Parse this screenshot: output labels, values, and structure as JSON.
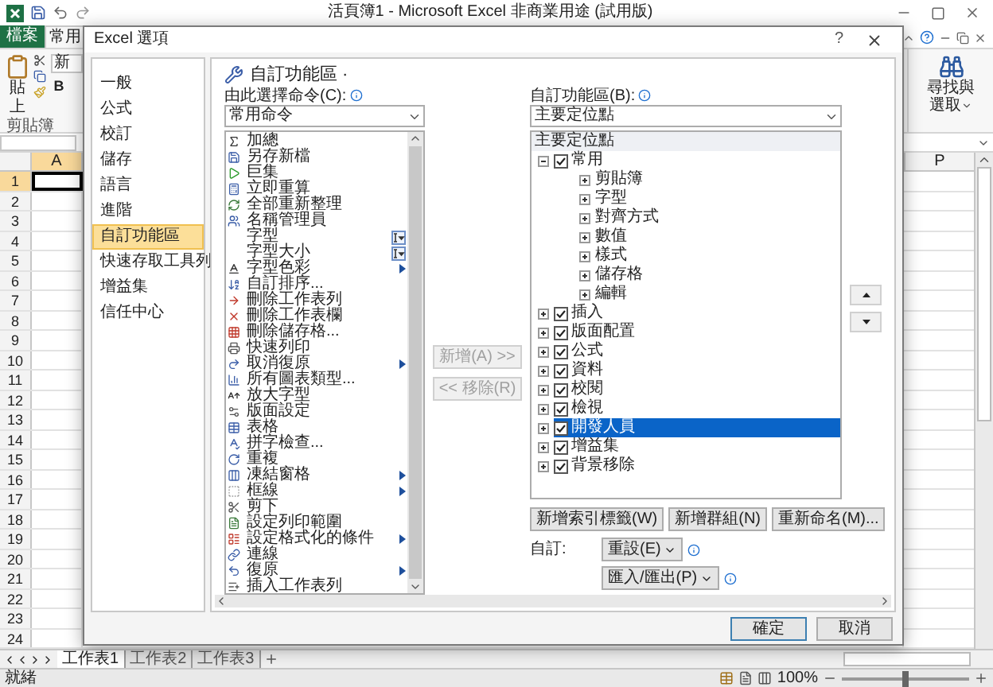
{
  "excel": {
    "title": "活頁簿1 - Microsoft Excel 非商業用途 (試用版)",
    "file_tab": "檔案",
    "tabs": [
      {
        "label": "常用",
        "selected": true
      }
    ],
    "paste": "貼上",
    "font_box": "新",
    "bold": "B",
    "clipboard_group": "剪貼簿",
    "find_select": [
      "尋找與",
      "選取"
    ],
    "columns": [
      {
        "label": "A",
        "selected": true
      },
      {
        "label": "P",
        "selected": false
      }
    ],
    "rows": [
      {
        "label": "1",
        "selected": true
      },
      {
        "label": "2",
        "selected": false
      },
      {
        "label": "3",
        "selected": false
      },
      {
        "label": "4",
        "selected": false
      },
      {
        "label": "5",
        "selected": false
      },
      {
        "label": "6",
        "selected": false
      },
      {
        "label": "7",
        "selected": false
      },
      {
        "label": "8",
        "selected": false
      },
      {
        "label": "9",
        "selected": false
      },
      {
        "label": "10",
        "selected": false
      },
      {
        "label": "11",
        "selected": false
      },
      {
        "label": "12",
        "selected": false
      },
      {
        "label": "13",
        "selected": false
      },
      {
        "label": "14",
        "selected": false
      },
      {
        "label": "15",
        "selected": false
      },
      {
        "label": "16",
        "selected": false
      },
      {
        "label": "17",
        "selected": false
      },
      {
        "label": "18",
        "selected": false
      },
      {
        "label": "19",
        "selected": false
      },
      {
        "label": "20",
        "selected": false
      },
      {
        "label": "21",
        "selected": false
      },
      {
        "label": "22",
        "selected": false
      },
      {
        "label": "23",
        "selected": false
      },
      {
        "label": "24",
        "selected": false
      }
    ],
    "sheets": [
      {
        "label": "工作表1",
        "selected": true
      },
      {
        "label": "工作表2",
        "selected": false
      },
      {
        "label": "工作表3",
        "selected": false
      }
    ],
    "status_bar": {
      "status": "就緒",
      "zoom": "100%",
      "level": 0.5
    }
  },
  "dialog": {
    "title": "Excel 選項",
    "help": "?",
    "nav": [
      {
        "label": "一般",
        "selected": false
      },
      {
        "label": "公式",
        "selected": false
      },
      {
        "label": "校訂",
        "selected": false
      },
      {
        "label": "儲存",
        "selected": false
      },
      {
        "label": "語言",
        "selected": false
      },
      {
        "label": "進階",
        "selected": false
      },
      {
        "label": "自訂功能區",
        "selected": true
      },
      {
        "label": "快速存取工具列",
        "selected": false
      },
      {
        "label": "增益集",
        "selected": false
      },
      {
        "label": "信任中心",
        "selected": false
      }
    ],
    "heading": "自訂功能區 ·",
    "commands_label": "由此選擇命令(C):",
    "commands_dropdown": "常用命令",
    "commands": [
      {
        "label": "加總",
        "kind": "plain"
      },
      {
        "label": "另存新檔",
        "kind": "plain"
      },
      {
        "label": "巨集",
        "kind": "plain"
      },
      {
        "label": "立即重算",
        "kind": "plain"
      },
      {
        "label": "全部重新整理",
        "kind": "plain"
      },
      {
        "label": "名稱管理員",
        "kind": "plain"
      },
      {
        "label": "字型",
        "kind": "picker"
      },
      {
        "label": "字型大小",
        "kind": "picker"
      },
      {
        "label": "字型色彩",
        "kind": "submenu"
      },
      {
        "label": "自訂排序...",
        "kind": "plain"
      },
      {
        "label": "刪除工作表列",
        "kind": "plain"
      },
      {
        "label": "刪除工作表欄",
        "kind": "plain"
      },
      {
        "label": "刪除儲存格...",
        "kind": "plain"
      },
      {
        "label": "快速列印",
        "kind": "plain"
      },
      {
        "label": "取消復原",
        "kind": "submenu"
      },
      {
        "label": "所有圖表類型...",
        "kind": "plain"
      },
      {
        "label": "放大字型",
        "kind": "plain"
      },
      {
        "label": "版面設定",
        "kind": "plain"
      },
      {
        "label": "表格",
        "kind": "plain"
      },
      {
        "label": "拼字檢查...",
        "kind": "plain"
      },
      {
        "label": "重複",
        "kind": "plain"
      },
      {
        "label": "凍結窗格",
        "kind": "submenu"
      },
      {
        "label": "框線",
        "kind": "submenu"
      },
      {
        "label": "剪下",
        "kind": "plain"
      },
      {
        "label": "設定列印範圍",
        "kind": "plain"
      },
      {
        "label": "設定格式化的條件",
        "kind": "submenu"
      },
      {
        "label": "連線",
        "kind": "plain"
      },
      {
        "label": "復原",
        "kind": "submenu"
      },
      {
        "label": "插入工作表列",
        "kind": "plain"
      }
    ],
    "add_button": {
      "label": "新增(A) >>",
      "disabled": true
    },
    "remove_button": {
      "label": "<< 移除(R)",
      "disabled": true
    },
    "ribbon_label": "自訂功能區(B):",
    "ribbon_dropdown": "主要定位點",
    "tree_header": "主要定位點",
    "tree": [
      {
        "label": "常用",
        "checked": true,
        "expanded": true,
        "selected": false,
        "children": [
          {
            "label": "剪貼簿",
            "expanded": false,
            "selected": false
          },
          {
            "label": "字型",
            "expanded": false,
            "selected": false
          },
          {
            "label": "對齊方式",
            "expanded": false,
            "selected": false
          },
          {
            "label": "數值",
            "expanded": false,
            "selected": false
          },
          {
            "label": "樣式",
            "expanded": false,
            "selected": false
          },
          {
            "label": "儲存格",
            "expanded": false,
            "selected": false
          },
          {
            "label": "編輯",
            "expanded": false,
            "selected": false
          }
        ]
      },
      {
        "label": "插入",
        "checked": true,
        "expanded": false,
        "selected": false
      },
      {
        "label": "版面配置",
        "checked": true,
        "expanded": false,
        "selected": false
      },
      {
        "label": "公式",
        "checked": true,
        "expanded": false,
        "selected": false
      },
      {
        "label": "資料",
        "checked": true,
        "expanded": false,
        "selected": false
      },
      {
        "label": "校閱",
        "checked": true,
        "expanded": false,
        "selected": false
      },
      {
        "label": "檢視",
        "checked": true,
        "expanded": false,
        "selected": false
      },
      {
        "label": "開發人員",
        "checked": true,
        "expanded": false,
        "selected": true
      },
      {
        "label": "增益集",
        "checked": true,
        "expanded": false,
        "selected": false
      },
      {
        "label": "背景移除",
        "checked": true,
        "expanded": false,
        "selected": false
      }
    ],
    "tree_buttons": [
      "新增索引標籤(W)",
      "新增群組(N)",
      "重新命名(M)..."
    ],
    "customize_label": "自訂:",
    "reset_button": "重設(E)",
    "import_export_button": "匯入/匯出(P)",
    "ok": "確定",
    "cancel": "取消"
  }
}
